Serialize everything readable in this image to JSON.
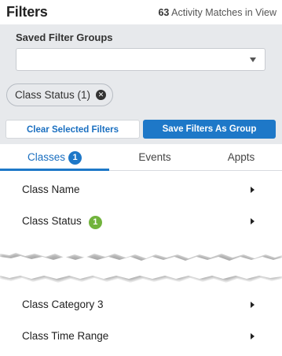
{
  "header": {
    "title": "Filters",
    "match_count": "63",
    "match_text": "Activity Matches in View"
  },
  "saved_groups": {
    "label": "Saved Filter Groups",
    "selected_value": ""
  },
  "active_chips": [
    {
      "label": "Class Status (1)"
    }
  ],
  "buttons": {
    "clear": "Clear Selected Filters",
    "save": "Save Filters As Group"
  },
  "tabs": [
    {
      "label": "Classes",
      "count": "1",
      "active": true
    },
    {
      "label": "Events"
    },
    {
      "label": "Appts"
    }
  ],
  "filter_rows": [
    {
      "label": "Class Name"
    },
    {
      "label": "Class Status",
      "badge": "1"
    },
    {
      "label": "Class Category 3"
    },
    {
      "label": "Class Time Range"
    }
  ],
  "colors": {
    "accent": "#1e78c8",
    "badge_green": "#71b33c",
    "panel_gray": "#e7e9ec"
  }
}
